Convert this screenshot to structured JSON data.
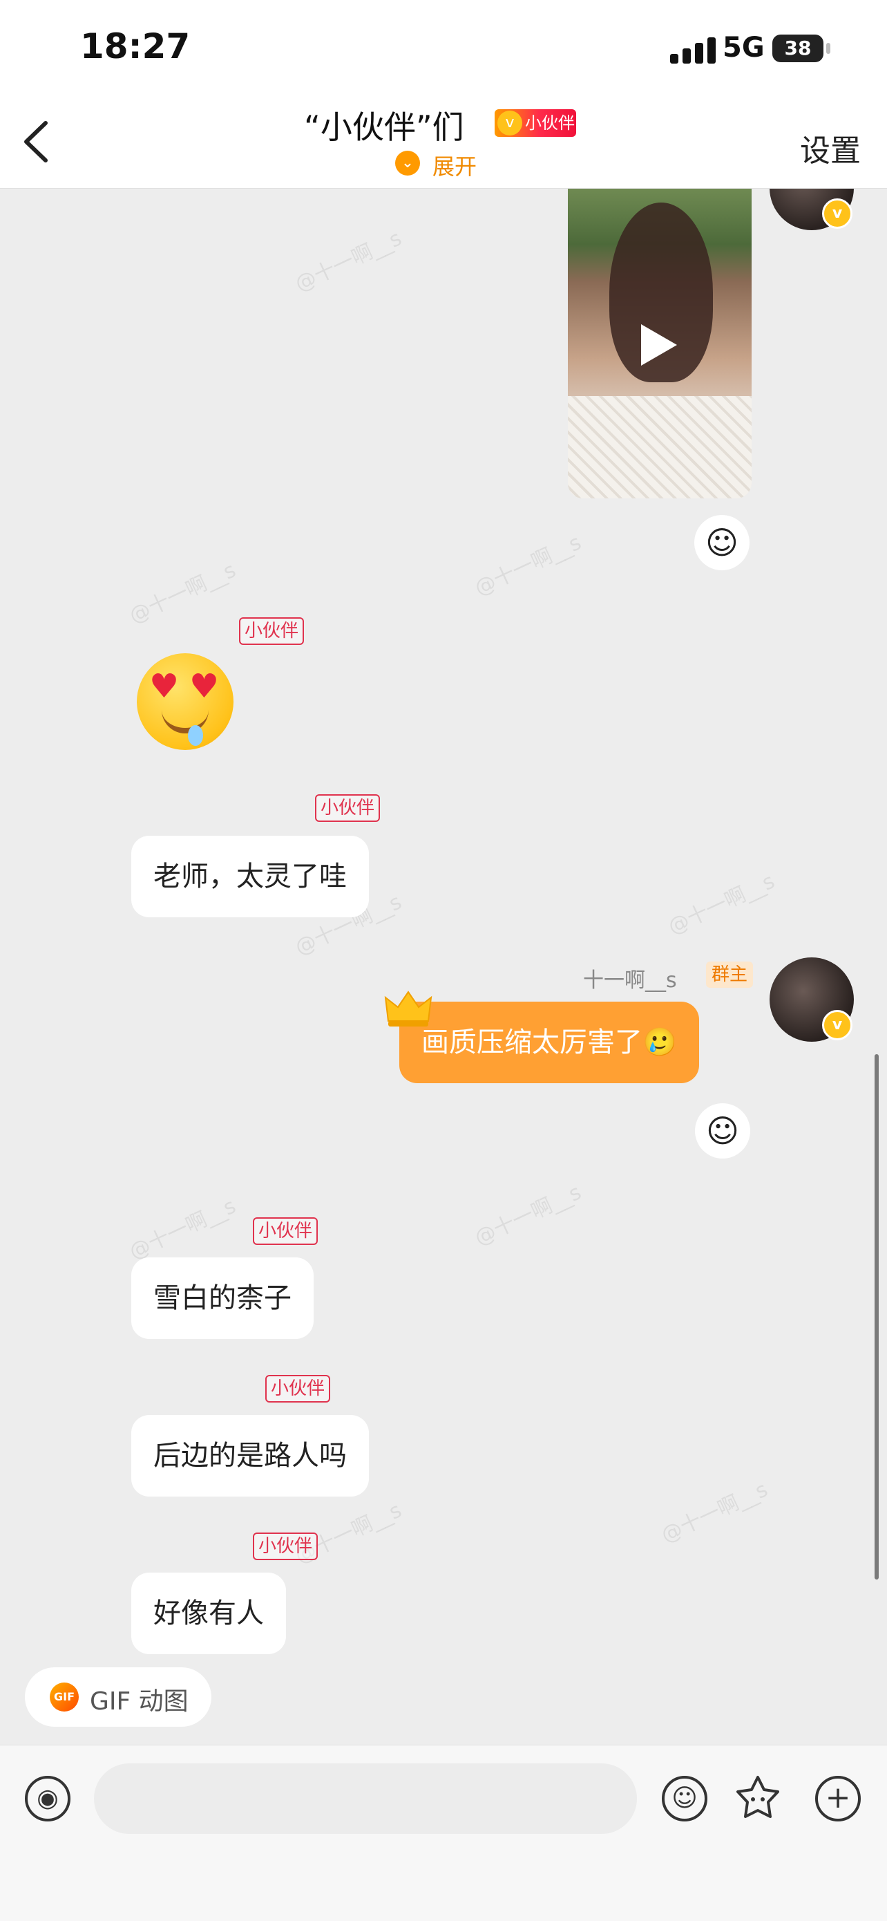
{
  "status_bar": {
    "time": "18:27",
    "network": "5G",
    "battery": "38"
  },
  "header": {
    "title": "“小伙伴”们",
    "badge": "小伙伴",
    "badge_icon": "v",
    "expand_label": "展开",
    "settings_label": "设置"
  },
  "watermark": "@十一啊__s",
  "messages": {
    "m1": {
      "type": "video",
      "react_icon": "add-reaction-icon"
    },
    "m2": {
      "tag": "小伙伴",
      "type": "emoji",
      "emoji_name": "heart-eyes-drooling-emoji"
    },
    "m3": {
      "tag": "小伙伴",
      "text": "老师，太灵了哇"
    },
    "m4": {
      "sender": "十一啊__s",
      "role": "群主",
      "text": "画质压缩太厉害了🥲",
      "avatar_badge": "v"
    },
    "m5": {
      "tag": "小伙伴",
      "text": "雪白的柰子"
    },
    "m6": {
      "tag": "小伙伴",
      "text": "后边的是路人吗"
    },
    "m7": {
      "tag": "小伙伴",
      "text": "好像有人"
    }
  },
  "gif_chip": {
    "icon_text": "GIF",
    "label": "GIF 动图"
  },
  "input_bar": {
    "placeholder": "",
    "value": ""
  },
  "colors": {
    "accent": "#ffa033",
    "tag_red": "#e0334e",
    "owner_orange": "#ee7a00",
    "vip_yellow": "#ffc21a"
  }
}
